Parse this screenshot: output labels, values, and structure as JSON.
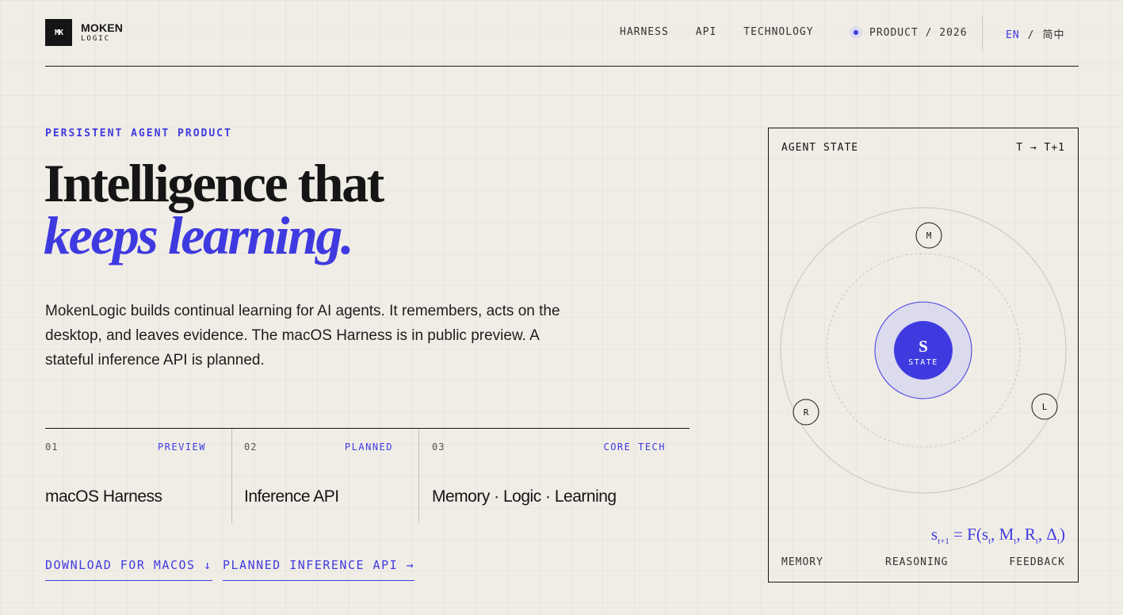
{
  "brand": {
    "mark": "MK",
    "name": "MOKEN",
    "sub": "LOGIC"
  },
  "nav": {
    "items": [
      "HARNESS",
      "API",
      "TECHNOLOGY"
    ]
  },
  "status": {
    "label": "PRODUCT / 2026"
  },
  "lang": {
    "current": "EN",
    "separator": "/",
    "alt": "简中"
  },
  "hero": {
    "eyebrow": "PERSISTENT AGENT PRODUCT",
    "headline_line1": "Intelligence that",
    "headline_line2": "keeps learning.",
    "lede": "MokenLogic builds continual learning for AI agents. It remembers, acts on the desktop, and leaves evidence. The macOS Harness is in public preview. A stateful inference API is planned."
  },
  "features": [
    {
      "num": "01",
      "tag": "PREVIEW",
      "title": "macOS Harness"
    },
    {
      "num": "02",
      "tag": "PLANNED",
      "title": "Inference API"
    },
    {
      "num": "03",
      "tag": "CORE TECH",
      "title": "Memory · Logic · Learning"
    }
  ],
  "ctas": {
    "download": "DOWNLOAD FOR MACOS ↓",
    "api": "PLANNED INFERENCE API →"
  },
  "panel": {
    "title": "AGENT STATE",
    "time": "T → T+1",
    "core_letter": "S",
    "core_label": "STATE",
    "nodes": {
      "m": "M",
      "r": "R",
      "l": "L"
    },
    "formula": {
      "s": "s",
      "s_sub": "t+1",
      "eq": " = F(",
      "s2": "s",
      "s2_sub": "t",
      "m": ", M",
      "m_sub": "t",
      "r": ", R",
      "r_sub": "t",
      "d": ", Δ",
      "d_sub": "t",
      "close": ")"
    },
    "footer": [
      "MEMORY",
      "REASONING",
      "FEEDBACK"
    ]
  },
  "colors": {
    "accent": "#3f3ae0",
    "ink": "#151515",
    "background": "#f0ede6"
  }
}
